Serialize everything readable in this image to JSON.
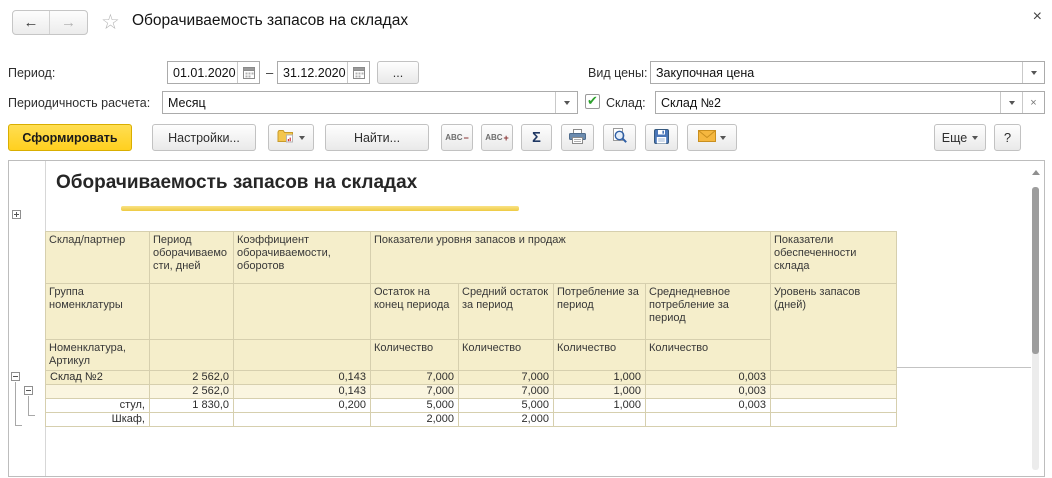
{
  "window": {
    "title": "Оборачиваемость запасов на складах",
    "icons": {
      "back": "←",
      "forward": "→",
      "favorite": "☆",
      "close": "×"
    }
  },
  "filters": {
    "period": {
      "label": "Период:",
      "from": "01.01.2020",
      "dash": "–",
      "to": "31.12.2020",
      "more": "..."
    },
    "periodicity": {
      "label": "Периодичность расчета:",
      "value": "Месяц"
    },
    "price_type": {
      "label": "Вид цены:",
      "value": "Закупочная цена"
    },
    "warehouse": {
      "label": "Склад:",
      "value": "Склад №2",
      "checked": true,
      "checkmark": "✔",
      "clear": "×"
    }
  },
  "toolbar": {
    "generate": "Сформировать",
    "settings": "Настройки...",
    "find": "Найти...",
    "abc": "ABC",
    "abc_minus": "−",
    "abc_plus": "+",
    "sigma": "Σ",
    "more": "Еще",
    "help": "?"
  },
  "report": {
    "title": "Оборачиваемость запасов на складах",
    "table": {
      "h1": [
        "Склад/партнер",
        "Период оборачиваемости, дней",
        "Коэффициент оборачиваемости, оборотов",
        "Показатели уровня запасов и продаж",
        "Показатели обеспеченности склада"
      ],
      "h2": [
        "Группа номенклатуры",
        "",
        "",
        "Остаток на конец периода",
        "Средний остаток за период",
        "Потребление за период",
        "Среднедневное потребление за период",
        "Уровень запасов (дней)"
      ],
      "h3": [
        "Номенклатура, Артикул",
        "",
        "",
        "Количество",
        "Количество",
        "Количество",
        "Количество"
      ],
      "rows": [
        {
          "name": "Склад №2",
          "values": [
            "2 562,0",
            "0,143",
            "7,000",
            "7,000",
            "1,000",
            "0,003",
            ""
          ]
        },
        {
          "name": "",
          "values": [
            "2 562,0",
            "0,143",
            "7,000",
            "7,000",
            "1,000",
            "0,003",
            ""
          ]
        },
        {
          "name": "стул,",
          "values": [
            "1 830,0",
            "0,200",
            "5,000",
            "5,000",
            "1,000",
            "0,003",
            ""
          ]
        },
        {
          "name": "Шкаф,",
          "values": [
            "",
            "",
            "2,000",
            "2,000",
            "",
            "",
            ""
          ]
        }
      ]
    }
  },
  "colors": {
    "accent_yellow": "#FFD332",
    "header_beige": "#F5EECB",
    "subgroup_beige": "#FAF5E0",
    "grid_line": "#D6CFAE",
    "underline_gold": "#F0CE4E",
    "icon_blue": "#4A76B8",
    "check_green": "#2DA12D"
  }
}
